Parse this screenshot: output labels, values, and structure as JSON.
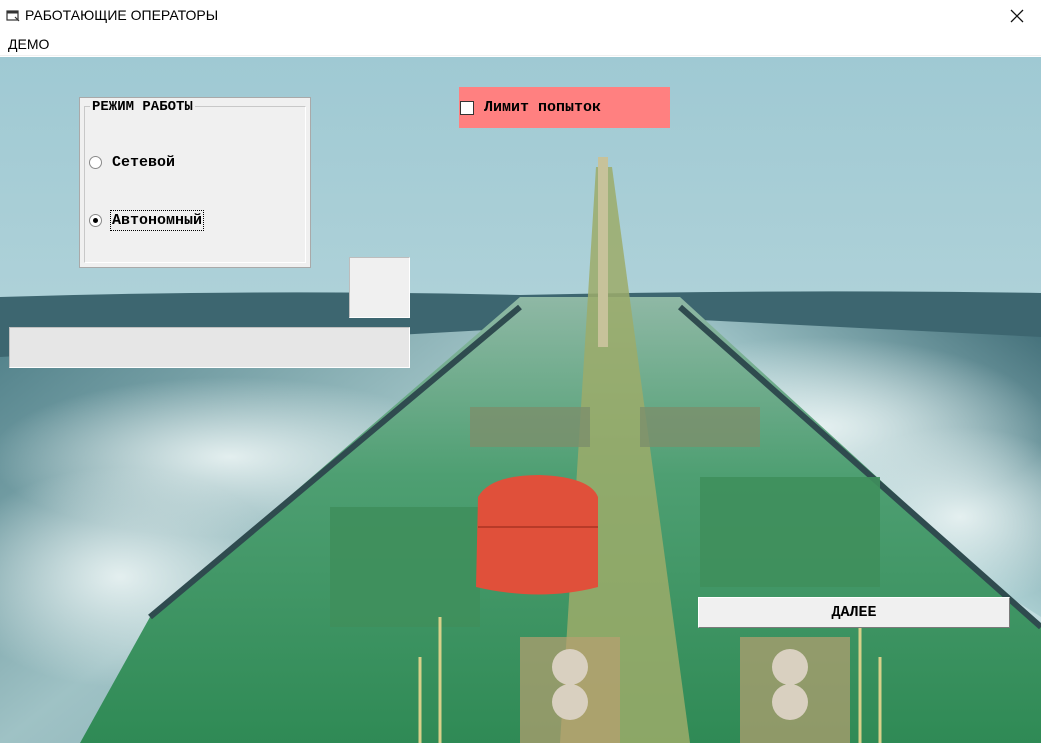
{
  "window": {
    "title": "РАБОТАЮЩИЕ ОПЕРАТОРЫ",
    "icon": "app-window-icon",
    "close_icon": "close-icon"
  },
  "menu": {
    "items": [
      {
        "label": "ДЕМО"
      }
    ]
  },
  "mode_group": {
    "title": "РЕЖИМ РАБОТЫ",
    "options": [
      {
        "label": "Сетевой",
        "selected": false
      },
      {
        "label": "Автономный",
        "selected": true
      }
    ]
  },
  "limit": {
    "label": "Лимит попыток",
    "checked": false,
    "background": "#ff8080"
  },
  "next_button": {
    "label": "ДАЛЕЕ"
  },
  "colors": {
    "panel": "#f0f0f0",
    "sea": "#5f8f95",
    "deck": "#3f9f6a",
    "lifeboat": "#e0503a"
  }
}
